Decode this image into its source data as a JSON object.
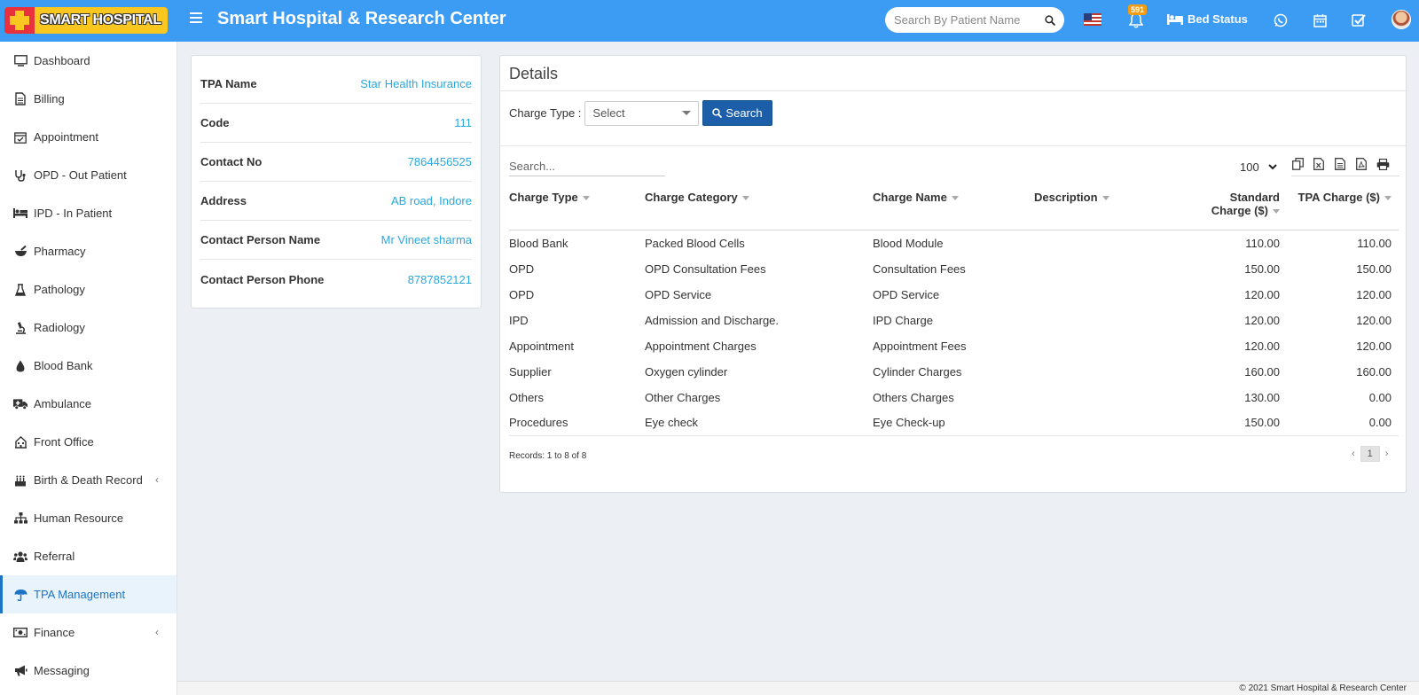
{
  "header": {
    "logo_text": "SMART HOSPITAL",
    "title": "Smart Hospital & Research Center",
    "search_placeholder": "Search By Patient Name",
    "notification_count": "591",
    "bed_status_label": "Bed Status"
  },
  "sidebar": {
    "items": [
      {
        "label": "Dashboard",
        "icon": "monitor-icon"
      },
      {
        "label": "Billing",
        "icon": "invoice-icon"
      },
      {
        "label": "Appointment",
        "icon": "calendar-check-icon"
      },
      {
        "label": "OPD - Out Patient",
        "icon": "stethoscope-icon"
      },
      {
        "label": "IPD - In Patient",
        "icon": "bed-icon"
      },
      {
        "label": "Pharmacy",
        "icon": "mortar-pestle-icon"
      },
      {
        "label": "Pathology",
        "icon": "flask-icon"
      },
      {
        "label": "Radiology",
        "icon": "microscope-icon"
      },
      {
        "label": "Blood Bank",
        "icon": "tint-icon"
      },
      {
        "label": "Ambulance",
        "icon": "ambulance-icon"
      },
      {
        "label": "Front Office",
        "icon": "building-icon"
      },
      {
        "label": "Birth & Death Record",
        "icon": "birthday-cake-icon"
      },
      {
        "label": "Human Resource",
        "icon": "sitemap-icon"
      },
      {
        "label": "Referral",
        "icon": "users-icon"
      },
      {
        "label": "TPA Management",
        "icon": "umbrella-icon"
      },
      {
        "label": "Finance",
        "icon": "money-icon"
      },
      {
        "label": "Messaging",
        "icon": "bullhorn-icon"
      }
    ],
    "active": "TPA Management"
  },
  "tpa_info": {
    "rows": [
      {
        "label": "TPA Name",
        "value": "Star Health Insurance"
      },
      {
        "label": "Code",
        "value": "111"
      },
      {
        "label": "Contact No",
        "value": "7864456525"
      },
      {
        "label": "Address",
        "value": "AB road, Indore"
      },
      {
        "label": "Contact Person Name",
        "value": "Mr Vineet sharma"
      },
      {
        "label": "Contact Person Phone",
        "value": "8787852121"
      }
    ]
  },
  "details": {
    "title": "Details",
    "charge_type_label": "Charge Type :",
    "charge_type_value": "Select",
    "search_button": "Search",
    "table_search_placeholder": "Search...",
    "page_size": "100",
    "columns": [
      "Charge Type",
      "Charge Category",
      "Charge Name",
      "Description",
      "Standard Charge ($)",
      "TPA Charge ($)"
    ],
    "rows": [
      [
        "Blood Bank",
        "Packed Blood Cells",
        "Blood Module",
        "",
        "110.00",
        "110.00"
      ],
      [
        "OPD",
        "OPD Consultation Fees",
        "Consultation Fees",
        "",
        "150.00",
        "150.00"
      ],
      [
        "OPD",
        "OPD Service",
        "OPD Service",
        "",
        "120.00",
        "120.00"
      ],
      [
        "IPD",
        "Admission and Discharge.",
        "IPD Charge",
        "",
        "120.00",
        "120.00"
      ],
      [
        "Appointment",
        "Appointment Charges",
        "Appointment Fees",
        "",
        "120.00",
        "120.00"
      ],
      [
        "Supplier",
        "Oxygen cylinder",
        "Cylinder Charges",
        "",
        "160.00",
        "160.00"
      ],
      [
        "Others",
        "Other Charges",
        "Others Charges",
        "",
        "130.00",
        "0.00"
      ],
      [
        "Procedures",
        "Eye check",
        "Eye Check-up",
        "",
        "150.00",
        "0.00"
      ]
    ],
    "records_text": "Records: 1 to 8 of 8",
    "current_page": "1"
  },
  "footer": {
    "text": "© 2021 Smart Hospital & Research Center"
  },
  "colors": {
    "header_bg": "#3c9cf4",
    "accent": "#1d74c5",
    "link_value": "#29a8df",
    "search_button": "#1d5ea8"
  }
}
